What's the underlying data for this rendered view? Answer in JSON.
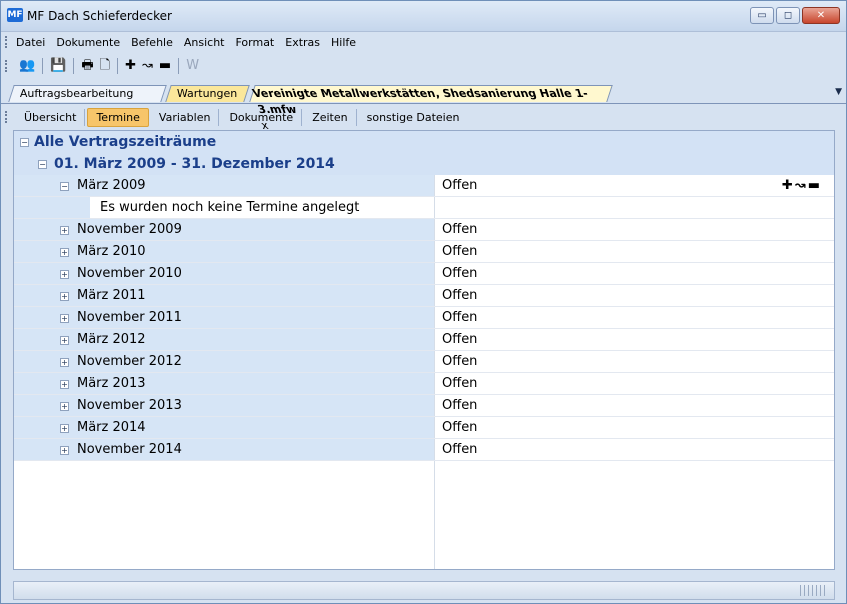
{
  "window": {
    "title": "MF Dach Schieferdecker",
    "icon": "app-logo-icon"
  },
  "menu": [
    "Datei",
    "Dokumente",
    "Befehle",
    "Ansicht",
    "Format",
    "Extras",
    "Hilfe"
  ],
  "toolbar": {
    "icons": [
      "users-icon",
      "save-icon",
      "print-icon",
      "print-preview-icon",
      "add-icon",
      "move-icon",
      "remove-icon",
      "word-icon"
    ]
  },
  "document_tabs": [
    {
      "label": "Auftragsbearbeitung"
    },
    {
      "label": "Wartungen"
    },
    {
      "label": "Vereinigte Metallwerkstätten, Shedsanierung Halle 1-3.mfw",
      "close": "x"
    }
  ],
  "sub_tabs": [
    "Übersicht",
    "Termine",
    "Variablen",
    "Dokumente",
    "Zeiten",
    "sonstige Dateien"
  ],
  "active_sub_tab": "Termine",
  "tree": {
    "root": "Alle Vertragszeiträume",
    "period": "01. März 2009  -  31. Dezember 2014",
    "expanded_item": {
      "label": "März 2009",
      "status": "Offen"
    },
    "empty_message": "Es wurden noch keine Termine angelegt",
    "items": [
      {
        "label": "November 2009",
        "status": "Offen"
      },
      {
        "label": "März 2010",
        "status": "Offen"
      },
      {
        "label": "November 2010",
        "status": "Offen"
      },
      {
        "label": "März 2011",
        "status": "Offen"
      },
      {
        "label": "November 2011",
        "status": "Offen"
      },
      {
        "label": "März 2012",
        "status": "Offen"
      },
      {
        "label": "November 2012",
        "status": "Offen"
      },
      {
        "label": "März 2013",
        "status": "Offen"
      },
      {
        "label": "November 2013",
        "status": "Offen"
      },
      {
        "label": "März 2014",
        "status": "Offen"
      },
      {
        "label": "November 2014",
        "status": "Offen"
      }
    ],
    "expand_symbol": "⊞",
    "collapse_symbol": "⊟"
  },
  "colors": {
    "accent_tab": "#f7c56a",
    "highlight": "#d6e5f6",
    "header_text": "#1b3f8a"
  }
}
